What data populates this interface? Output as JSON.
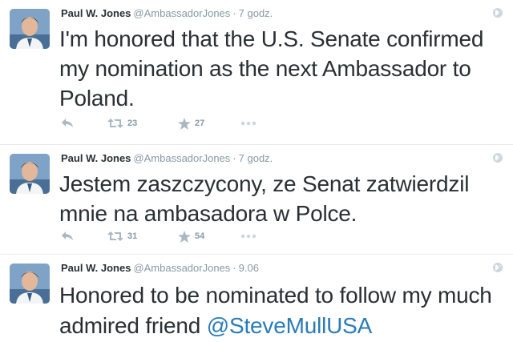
{
  "tweets": [
    {
      "name": "Paul W. Jones",
      "handle": "@AmbassadorJones",
      "separator": "·",
      "time": "7 godz.",
      "text": "I'm honored that the U.S. Senate confirmed my nomination as the next Ambassador to Poland.",
      "retweets": "23",
      "favorites": "27"
    },
    {
      "name": "Paul W. Jones",
      "handle": "@AmbassadorJones",
      "separator": "·",
      "time": "7 godz.",
      "text": "Jestem zaszczycony, ze Senat zatwierdzil mnie na ambasadora w Polce.",
      "retweets": "31",
      "favorites": "54"
    },
    {
      "name": "Paul W. Jones",
      "handle": "@AmbassadorJones",
      "separator": "·",
      "time": "9.06",
      "text": "Honored to be nominated to follow my much admired friend ",
      "mention": "@SteveMullUSA"
    }
  ],
  "icons": {
    "reply": "reply-icon",
    "retweet": "retweet-icon",
    "favorite": "star-icon",
    "more": "more-icon",
    "globe": "globe-icon",
    "avatar": "avatar"
  },
  "colors": {
    "text": "#292f33",
    "meta": "#8899a6",
    "mention": "#2b7bb9",
    "divider": "#e8ebed"
  }
}
